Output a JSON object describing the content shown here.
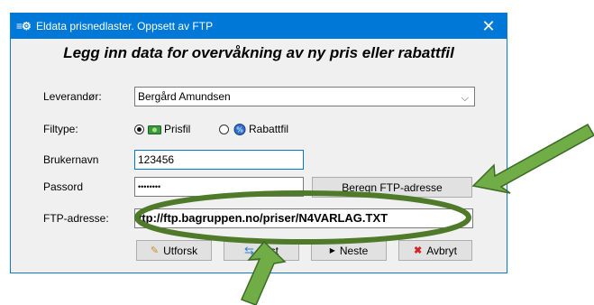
{
  "window": {
    "title": "Eldata prisnedlaster. Oppsett av FTP",
    "app_icon": "≡⚙",
    "close_glyph": "✕"
  },
  "heading": "Legg inn data for overvåkning av ny pris eller rabattfil",
  "fields": {
    "leverandor_label": "Leverandør:",
    "leverandor_value": "Bergård Amundsen",
    "filtype_label": "Filtype:",
    "prisfil_label": "Prisfil",
    "rabattfil_label": "Rabattfil",
    "selected_filetype": "Prisfil",
    "brukernavn_label": "Brukernavn",
    "brukernavn_value": "123456",
    "passord_label": "Passord",
    "passord_value": "••••••••",
    "ftp_label": "FTP-adresse:",
    "ftp_value": "ftp://ftp.bagruppen.no/priser/N4VARLAG.TXT"
  },
  "buttons": {
    "beregn": "Beregn FTP-adresse",
    "utforsk": "Utforsk",
    "test": "Test",
    "neste": "Neste",
    "avbryt": "Avbryt"
  },
  "icons": {
    "utforsk": "pencil-icon",
    "test": "refresh-arrows-icon",
    "neste": "play-arrow-icon",
    "avbryt": "red-x-icon"
  },
  "colors": {
    "titlebar": "#0078d7",
    "annotation_green": "#70ad47",
    "ellipse_green": "#4e7a2a"
  }
}
